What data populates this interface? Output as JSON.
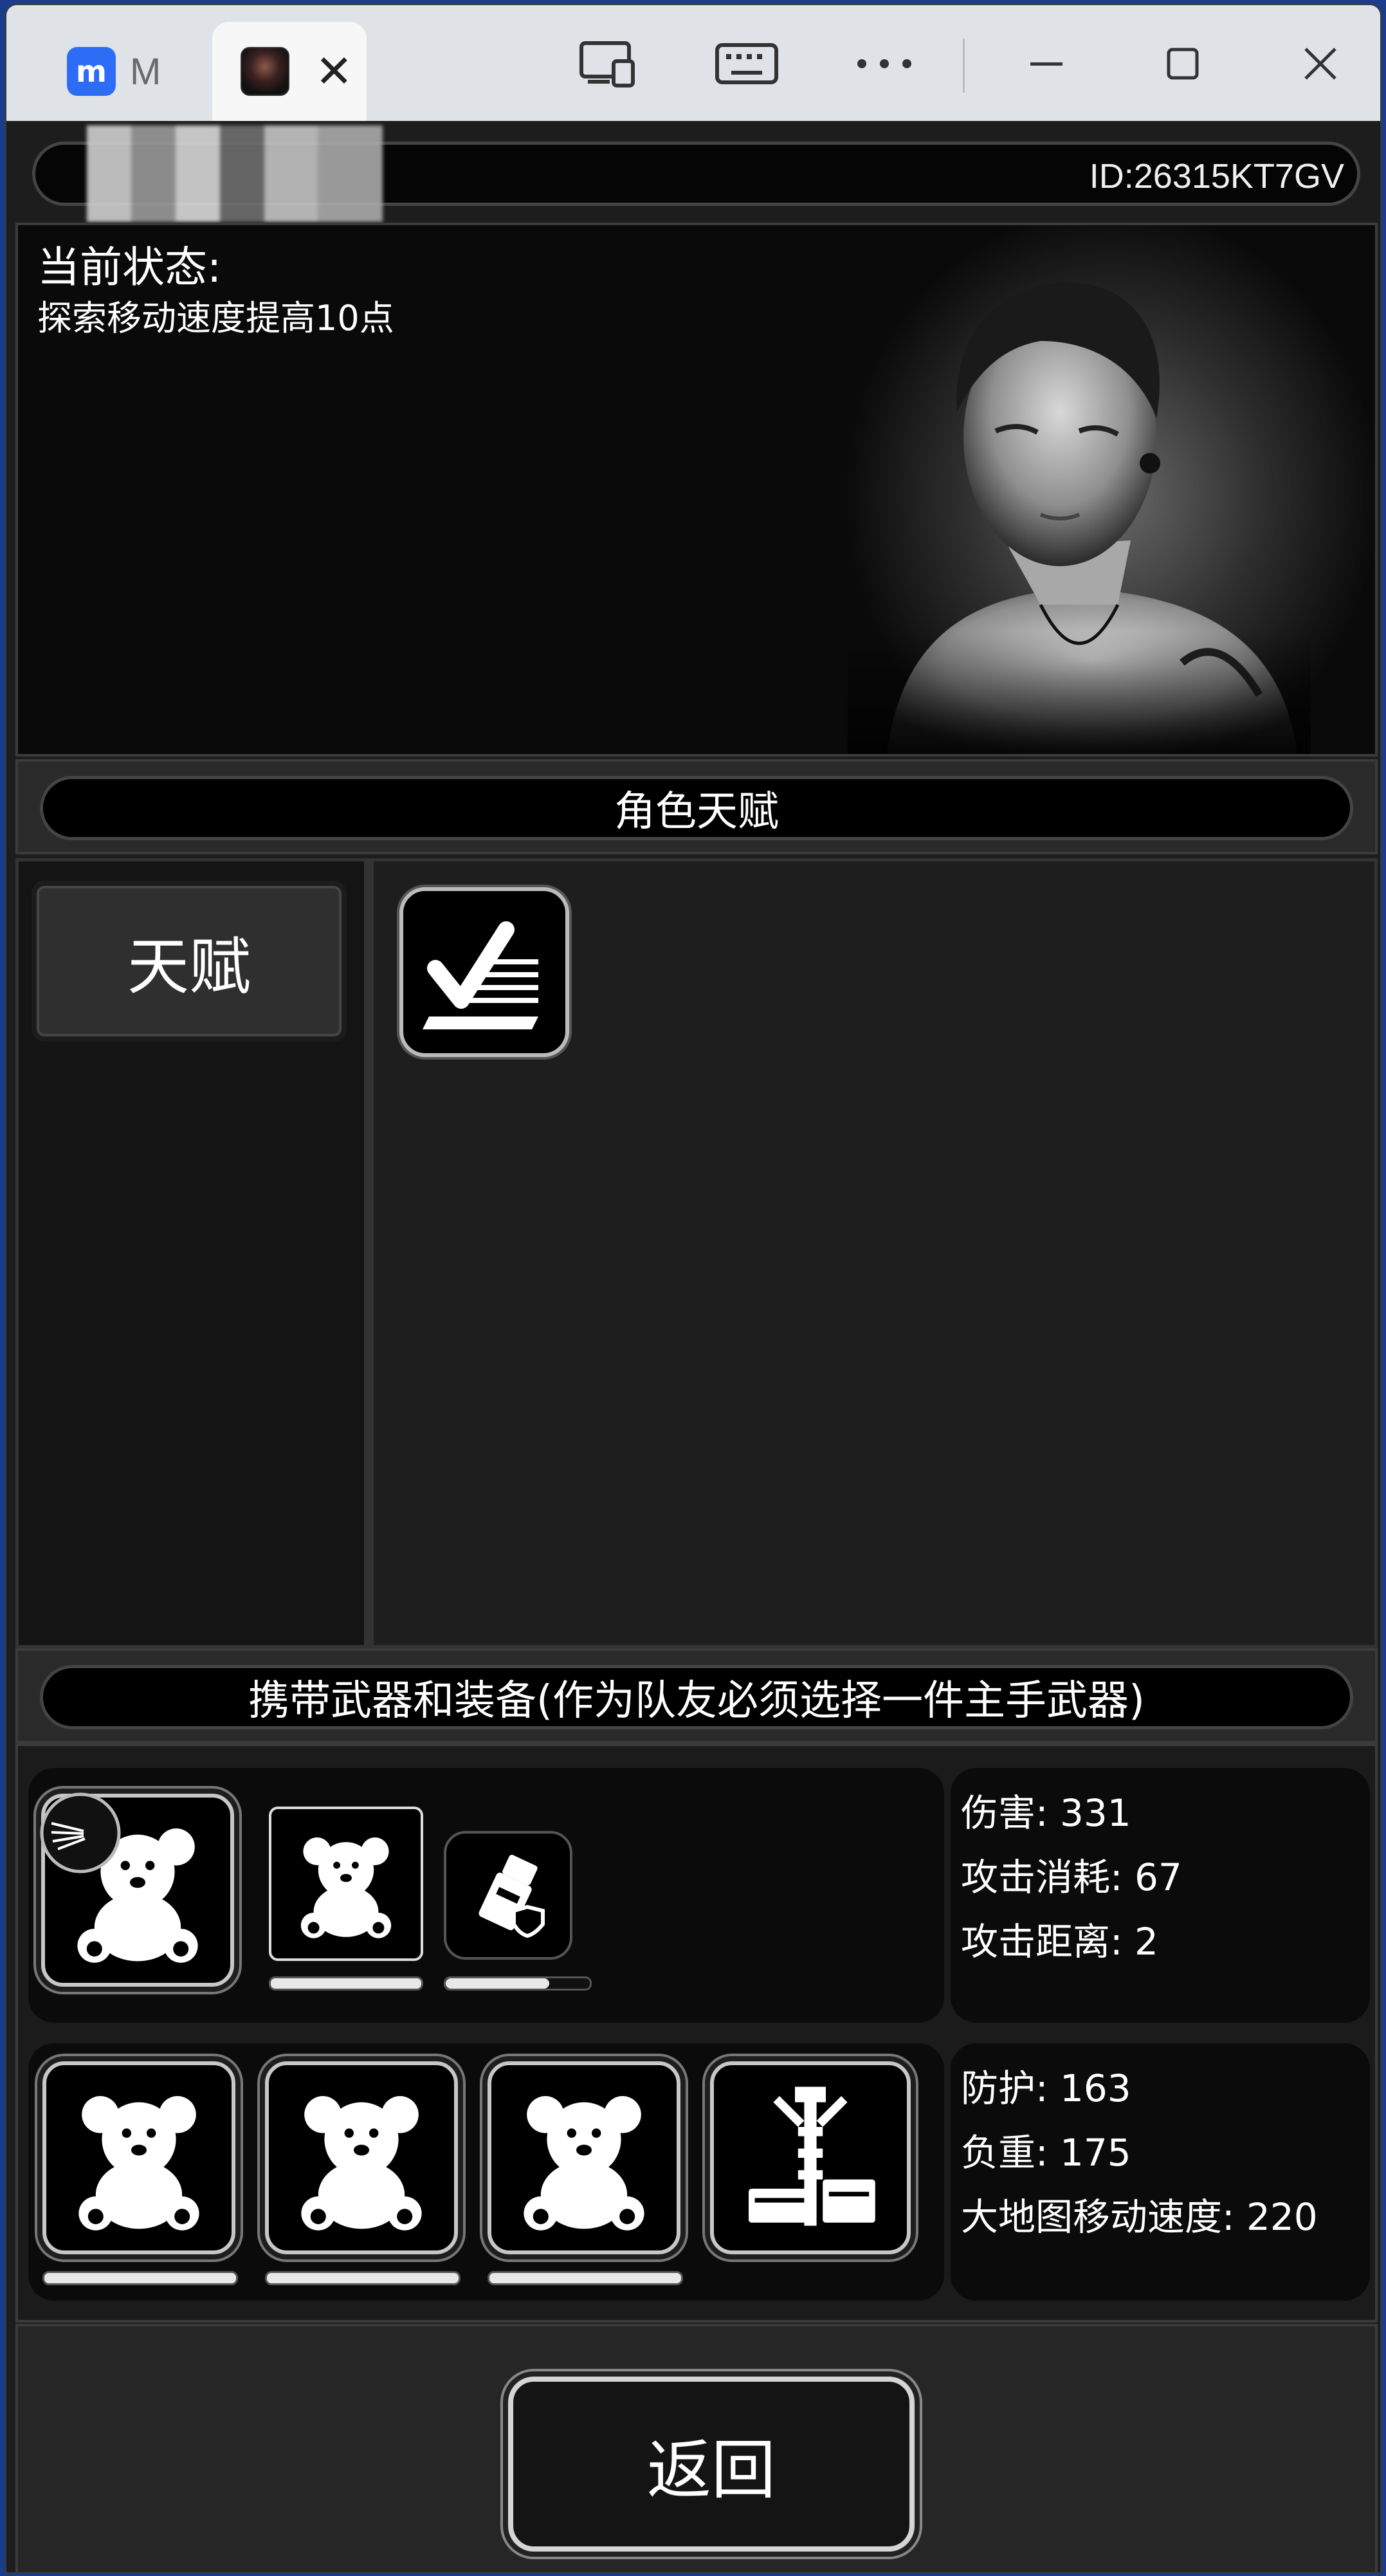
{
  "titlebar": {
    "tab1_label": "M",
    "tab2_close": "✕",
    "icons": [
      "cast-icon",
      "keyboard-icon",
      "more-icon",
      "minimize-icon",
      "maximize-icon",
      "close-icon"
    ]
  },
  "header": {
    "player_id": "ID:26315KT7GV"
  },
  "hero": {
    "status_title": "当前状态:",
    "status_text": "探索移动速度提高10点"
  },
  "talent": {
    "section_title": "角色天赋",
    "tab_label": "天赋"
  },
  "equipment": {
    "section_title": "携带武器和装备(作为队友必须选择一件主手武器)",
    "weapon_stats": [
      "伤害: 331",
      "攻击消耗: 67",
      "攻击距离:  2"
    ],
    "armor_stats": [
      "防护: 163",
      "负重: 175",
      "大地图移动速度:  220"
    ],
    "weapon_bars": [
      1.0,
      0.72
    ],
    "armor_bars": [
      1.0,
      1.0,
      1.0
    ]
  },
  "footer": {
    "return_label": "返回"
  }
}
